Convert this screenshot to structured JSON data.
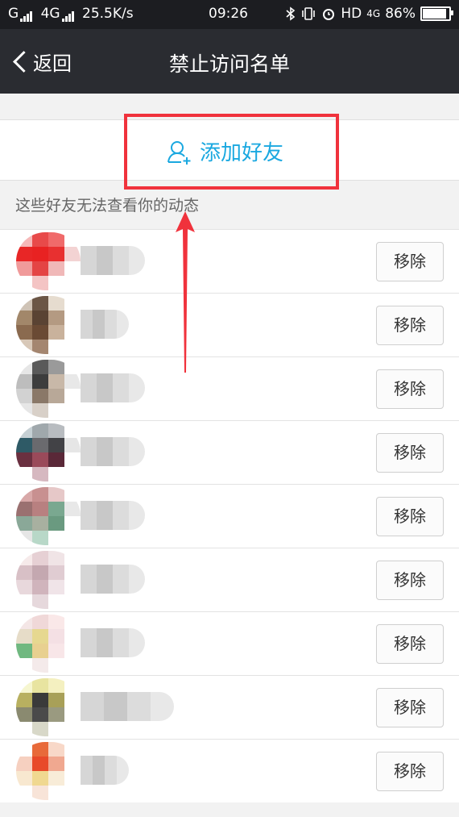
{
  "status_bar": {
    "left": "G",
    "net_type": "4G",
    "speed": "25.5K/s",
    "time": "09:26",
    "hd": "HD",
    "net2": "4G",
    "battery": "86%"
  },
  "header": {
    "back_label": "返回",
    "title": "禁止访问名单"
  },
  "add_friend": {
    "label": "添加好友"
  },
  "hint": "这些好友无法查看你的动态",
  "friends": [
    {
      "remove_label": "移除"
    },
    {
      "remove_label": "移除"
    },
    {
      "remove_label": "移除"
    },
    {
      "remove_label": "移除"
    },
    {
      "remove_label": "移除"
    },
    {
      "remove_label": "移除"
    },
    {
      "remove_label": "移除"
    },
    {
      "remove_label": "移除"
    },
    {
      "remove_label": "移除"
    }
  ],
  "colors": {
    "accent": "#1aa8e0",
    "highlight": "#f0323c",
    "titlebar": "#2a2c31"
  }
}
